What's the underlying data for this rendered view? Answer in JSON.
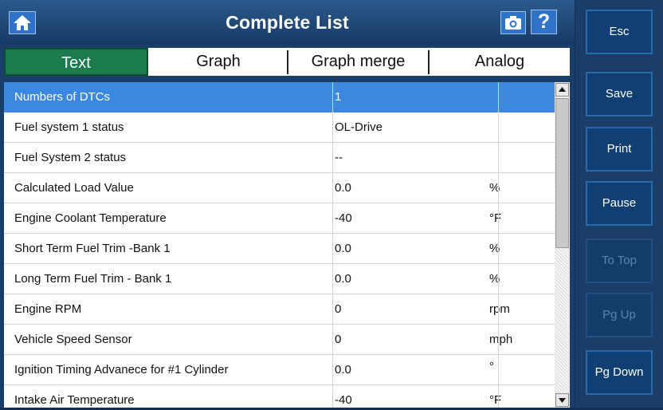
{
  "header": {
    "title": "Complete List"
  },
  "tabs": [
    {
      "label": "Text",
      "active": true
    },
    {
      "label": "Graph",
      "active": false
    },
    {
      "label": "Graph merge",
      "active": false
    },
    {
      "label": "Analog",
      "active": false
    }
  ],
  "rows": [
    {
      "name": "Numbers of DTCs",
      "value": "1",
      "unit": "",
      "selected": true
    },
    {
      "name": "Fuel system 1 status",
      "value": "OL-Drive",
      "unit": ""
    },
    {
      "name": "Fuel System 2 status",
      "value": "--",
      "unit": ""
    },
    {
      "name": "Calculated Load Value",
      "value": "0.0",
      "unit": "%"
    },
    {
      "name": "Engine Coolant Temperature",
      "value": "-40",
      "unit": "°F"
    },
    {
      "name": "Short Term Fuel Trim -Bank 1",
      "value": "0.0",
      "unit": "%"
    },
    {
      "name": "Long Term Fuel Trim - Bank 1",
      "value": "0.0",
      "unit": "%"
    },
    {
      "name": "Engine RPM",
      "value": "0",
      "unit": "rpm"
    },
    {
      "name": "Vehicle Speed Sensor",
      "value": "0",
      "unit": "mph"
    },
    {
      "name": "Ignition Timing Advanece for #1 Cylinder",
      "value": "0.0",
      "unit": "°"
    },
    {
      "name": "Intake Air Temperature",
      "value": "-40",
      "unit": "°F"
    }
  ],
  "side_buttons": [
    {
      "label": "Esc",
      "enabled": true
    },
    {
      "label": "Save",
      "enabled": true
    },
    {
      "label": "Print",
      "enabled": true
    },
    {
      "label": "Pause",
      "enabled": true
    },
    {
      "label": "To Top",
      "enabled": false
    },
    {
      "label": "Pg Up",
      "enabled": false
    },
    {
      "label": "Pg Down",
      "enabled": true
    }
  ],
  "icons": {
    "home": "home-icon",
    "camera": "camera-icon",
    "help": "?"
  },
  "colors": {
    "accent": "#3b88e0",
    "active_tab": "#1c7a4f",
    "panel": "#1a3d69"
  }
}
